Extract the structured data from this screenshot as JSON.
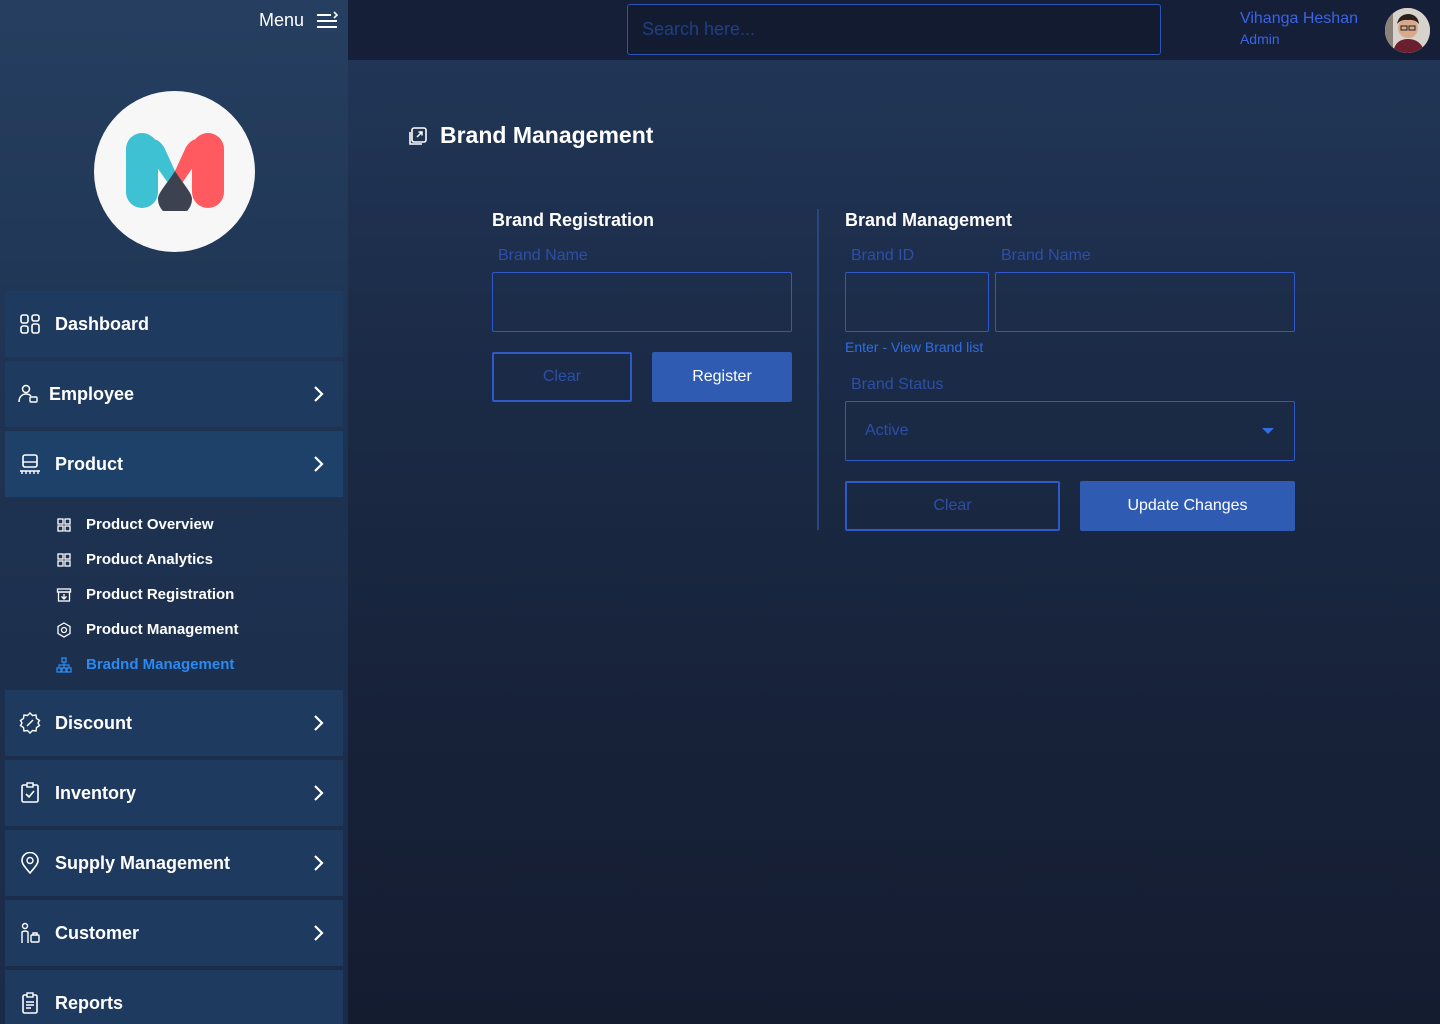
{
  "header": {
    "menu_label": "Menu",
    "search_placeholder": "Search here...",
    "user_name": "Vihanga Heshan",
    "user_role": "Admin"
  },
  "sidebar": {
    "items": [
      {
        "label": "Dashboard",
        "icon": "dashboard-grid-icon"
      },
      {
        "label": "Employee",
        "icon": "employee-icon"
      },
      {
        "label": "Product",
        "icon": "product-icon"
      },
      {
        "label": "Discount",
        "icon": "discount-badge-icon"
      },
      {
        "label": "Inventory",
        "icon": "inventory-clipboard-icon"
      },
      {
        "label": "Supply Management",
        "icon": "location-pin-icon"
      },
      {
        "label": "Customer",
        "icon": "customer-icon"
      },
      {
        "label": "Reports",
        "icon": "reports-icon"
      }
    ],
    "product_submenu": [
      {
        "label": "Product Overview",
        "icon": "grid-icon"
      },
      {
        "label": "Product Analytics",
        "icon": "grid-icon"
      },
      {
        "label": "Product Registration",
        "icon": "archive-icon"
      },
      {
        "label": "Product Management",
        "icon": "settings-cog-icon"
      },
      {
        "label": "Bradnd Management",
        "icon": "hierarchy-icon"
      }
    ]
  },
  "page": {
    "title": "Brand Management",
    "registration": {
      "title": "Brand Registration",
      "brand_name_label": "Brand Name",
      "clear_label": "Clear",
      "register_label": "Register"
    },
    "management": {
      "title": "Brand Management",
      "brand_id_label": "Brand ID",
      "brand_name_label": "Brand Name",
      "hint_link": "Enter - View Brand list",
      "status_label": "Brand Status",
      "status_value": "Active",
      "clear_label": "Clear",
      "update_label": "Update Changes"
    }
  },
  "colors": {
    "accent": "#2f5bb3",
    "link": "#2f6de0",
    "active_sub": "#2a8af0",
    "logo_left": "#3ec1d3",
    "logo_right": "#ff5a5f",
    "logo_drop": "#3d4250"
  }
}
